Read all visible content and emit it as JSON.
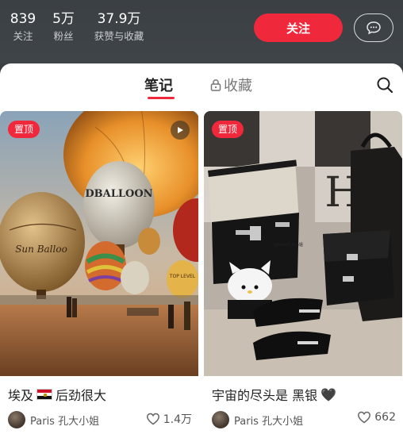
{
  "profile_stats": {
    "following": {
      "value": "839",
      "label": "关注"
    },
    "fans": {
      "value": "5万",
      "label": "粉丝"
    },
    "likes": {
      "value": "37.9万",
      "label": "获赞与收藏"
    }
  },
  "actions": {
    "follow_label": "关注",
    "message_icon": "chat-bubble-icon"
  },
  "tabs": {
    "notes": "笔记",
    "saved": "收藏",
    "saved_icon": "lock-icon",
    "search_icon": "search-icon"
  },
  "colors": {
    "accent": "#f0283c",
    "header_bg": "#3b4045"
  },
  "cards": [
    {
      "badge": "置顶",
      "is_video": true,
      "title_prefix": "埃及",
      "title_flag": "egypt-flag",
      "title_suffix": "后劲很大",
      "author": "Paris 孔大小姐",
      "likes": "1.4万"
    },
    {
      "badge": "置顶",
      "is_video": false,
      "title_text": "宇宙的尽头是 黑银",
      "title_emoji": "🖤",
      "author": "Paris 孔大小姐",
      "likes": "662"
    }
  ]
}
